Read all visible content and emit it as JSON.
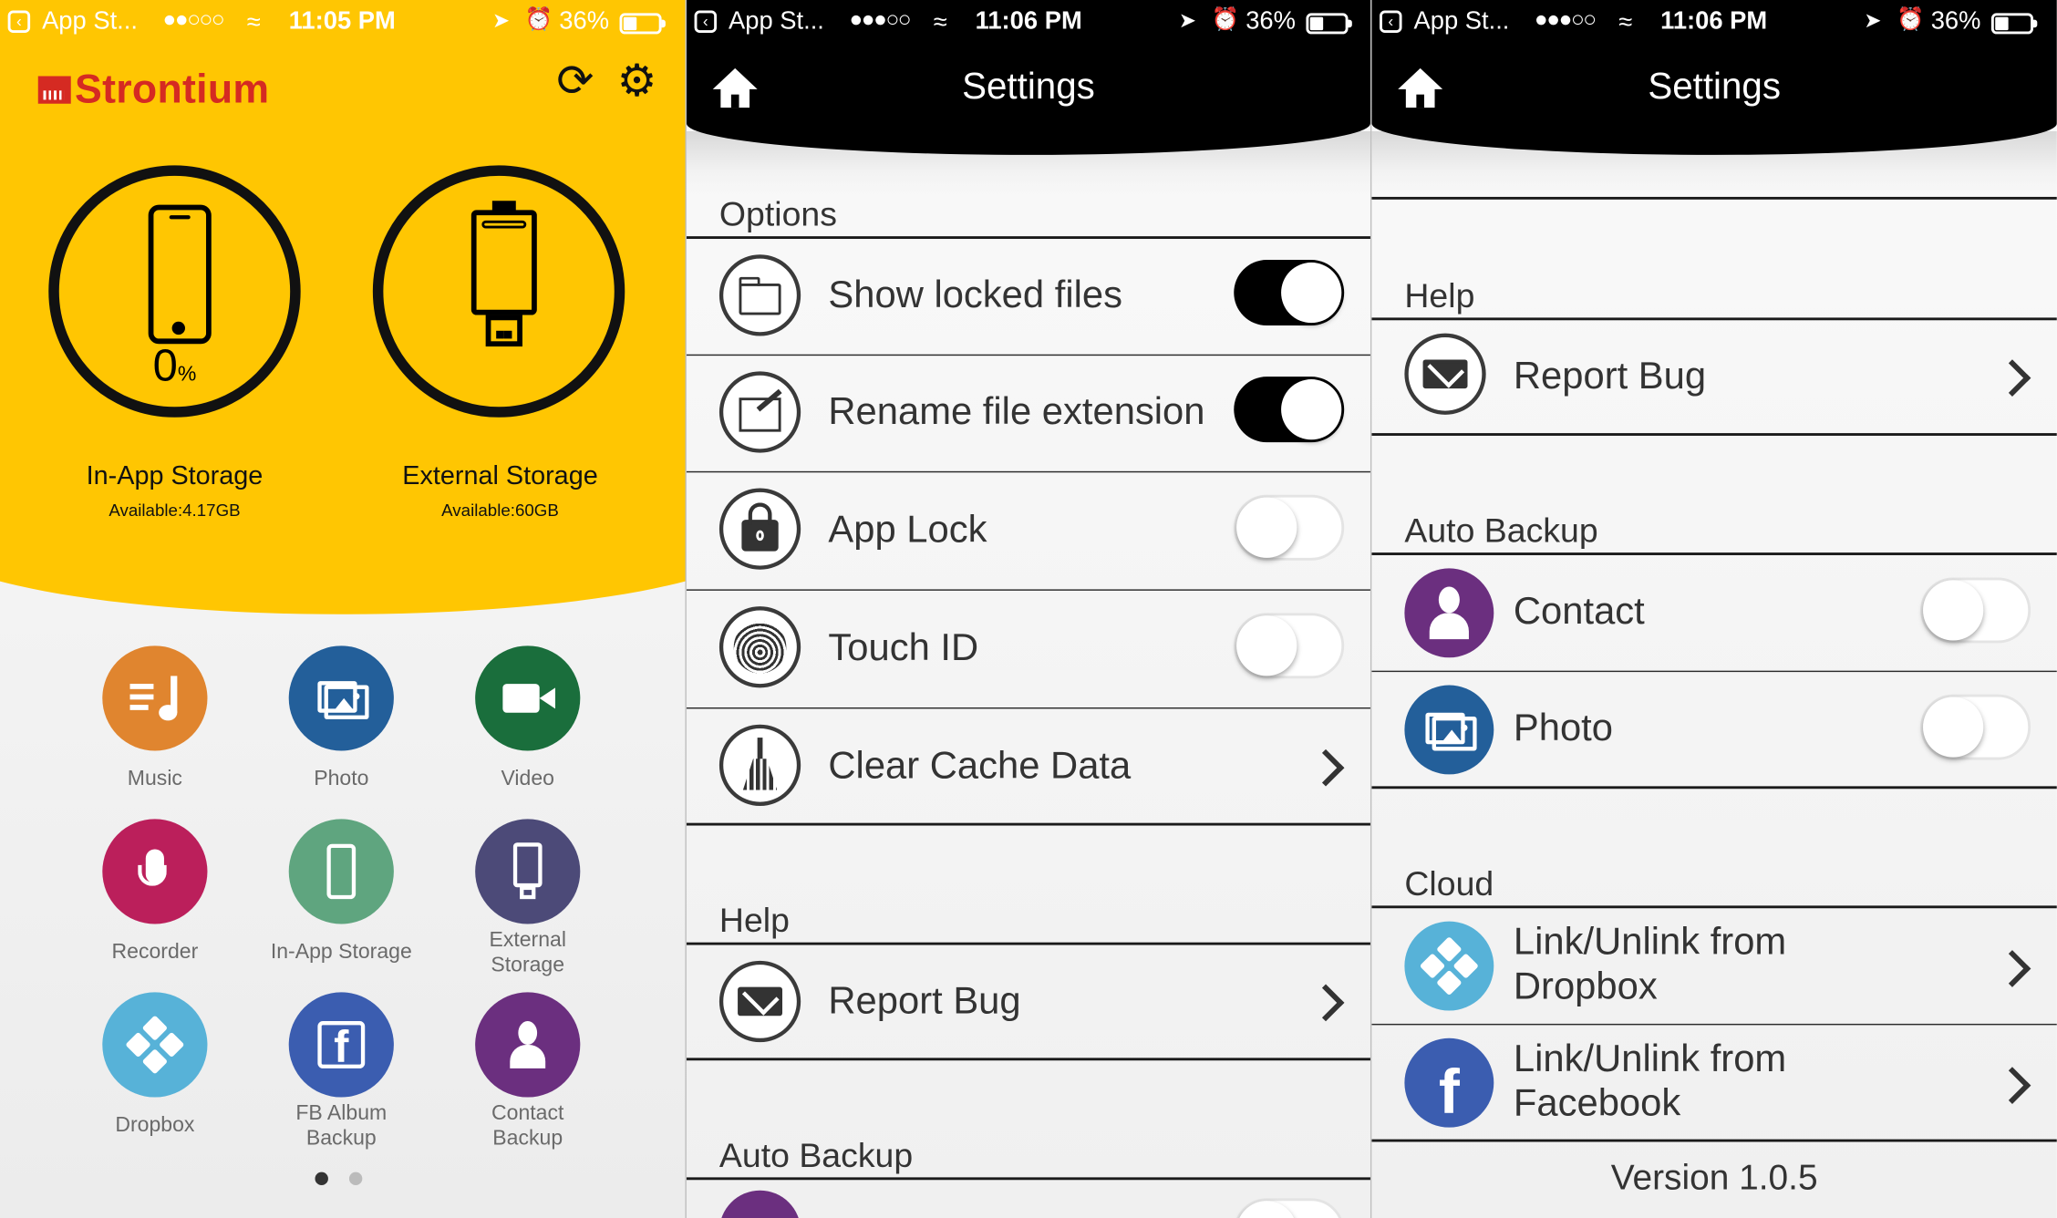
{
  "status_bar": [
    {
      "back_app": "App St...",
      "signal": "●●○○○",
      "time": "11:05 PM",
      "battery": "36%"
    },
    {
      "back_app": "App St...",
      "signal": "●●●○○",
      "time": "11:06 PM",
      "battery": "36%"
    },
    {
      "back_app": "App St...",
      "signal": "●●●○○",
      "time": "11:06 PM",
      "battery": "36%"
    }
  ],
  "home": {
    "logo": "Strontium",
    "storage": [
      {
        "label": "In-App Storage",
        "available": "Available:4.17GB",
        "percent": "0",
        "percent_unit": "%"
      },
      {
        "label": "External Storage",
        "available": "Available:60GB"
      }
    ],
    "apps": [
      {
        "label": "Music",
        "color": "#e0852f"
      },
      {
        "label": "Photo",
        "color": "#235f9a"
      },
      {
        "label": "Video",
        "color": "#1a6e3c"
      },
      {
        "label": "Recorder",
        "color": "#bb1f5b"
      },
      {
        "label": "In-App Storage",
        "color": "#5fa57f"
      },
      {
        "label": "External Storage",
        "color": "#4c4a78"
      },
      {
        "label": "Dropbox",
        "color": "#57b2d8"
      },
      {
        "label": "FB Album Backup",
        "color": "#3b5db0"
      },
      {
        "label": "Contact Backup",
        "color": "#6b2f7f"
      }
    ],
    "page_dots": {
      "count": 2,
      "active": 0
    }
  },
  "settings_left": {
    "title": "Settings",
    "options_header": "Options",
    "options": [
      {
        "label": "Show locked files",
        "toggle": true
      },
      {
        "label": "Rename file extension",
        "toggle": true
      },
      {
        "label": "App Lock",
        "toggle": false
      },
      {
        "label": "Touch ID",
        "toggle": false
      },
      {
        "label": "Clear Cache Data"
      }
    ],
    "help_header": "Help",
    "report_bug": "Report Bug",
    "auto_backup_header": "Auto Backup"
  },
  "settings_right": {
    "title": "Settings",
    "help_header": "Help",
    "report_bug": "Report Bug",
    "auto_backup_header": "Auto Backup",
    "auto_backup": [
      {
        "label": "Contact",
        "toggle": false,
        "color": "#6b2f7f"
      },
      {
        "label": "Photo",
        "toggle": false,
        "color": "#235f9a"
      }
    ],
    "cloud_header": "Cloud",
    "cloud": [
      {
        "line1": "Link/Unlink from",
        "line2": "Dropbox",
        "color": "#57b2d8"
      },
      {
        "line1": "Link/Unlink from",
        "line2": "Facebook",
        "color": "#3b5db0"
      }
    ],
    "version": "Version 1.0.5"
  }
}
